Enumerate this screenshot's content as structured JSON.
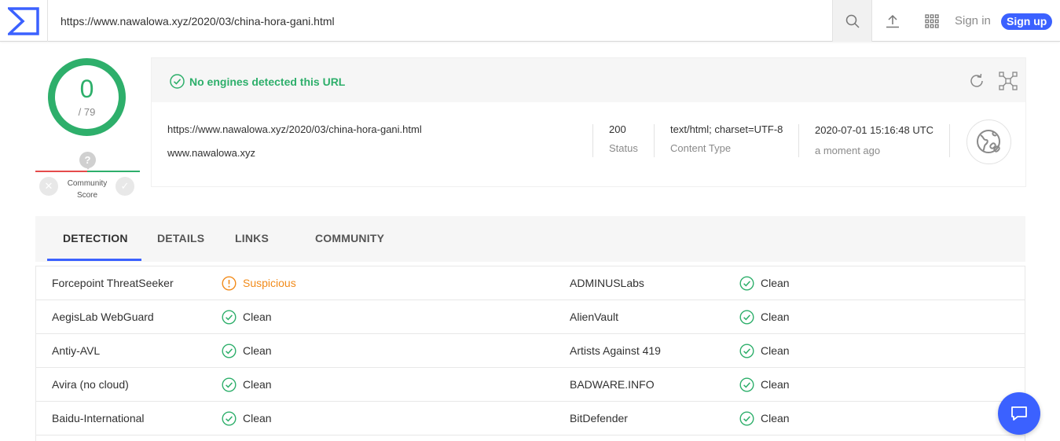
{
  "header": {
    "url_value": "https://www.nawalowa.xyz/2020/03/china-hora-gani.html",
    "signin_label": "Sign in",
    "signup_label": "Sign up",
    "icons": [
      "sigma-logo-icon",
      "search-icon",
      "upload-icon",
      "apps-grid-icon"
    ],
    "accent_color": "#3b61ff"
  },
  "score": {
    "detections": "0",
    "total": "/ 79",
    "community_label_line1": "Community",
    "community_label_line2": "Score",
    "community_value": "?",
    "colors": {
      "gauge": "#2eaf6b",
      "negative": "#e54b4b"
    }
  },
  "summary": {
    "verdict": "No engines detected this URL",
    "url": "https://www.nawalowa.xyz/2020/03/china-hora-gani.html",
    "domain": "www.nawalowa.xyz",
    "status_value": "200",
    "status_label": "Status",
    "content_type_value": "text/html; charset=UTF-8",
    "content_type_label": "Content Type",
    "date_value": "2020-07-01 15:16:48 UTC",
    "date_relative": "a moment ago"
  },
  "tabs": [
    {
      "label": "DETECTION",
      "active": true
    },
    {
      "label": "DETAILS",
      "active": false
    },
    {
      "label": "LINKS",
      "active": false
    },
    {
      "label": "COMMUNITY",
      "active": false
    }
  ],
  "detections": [
    {
      "left_engine": "Forcepoint ThreatSeeker",
      "left_result": "Suspicious",
      "left_status": "suspicious",
      "right_engine": "ADMINUSLabs",
      "right_result": "Clean",
      "right_status": "clean"
    },
    {
      "left_engine": "AegisLab WebGuard",
      "left_result": "Clean",
      "left_status": "clean",
      "right_engine": "AlienVault",
      "right_result": "Clean",
      "right_status": "clean"
    },
    {
      "left_engine": "Antiy-AVL",
      "left_result": "Clean",
      "left_status": "clean",
      "right_engine": "Artists Against 419",
      "right_result": "Clean",
      "right_status": "clean"
    },
    {
      "left_engine": "Avira (no cloud)",
      "left_result": "Clean",
      "left_status": "clean",
      "right_engine": "BADWARE.INFO",
      "right_result": "Clean",
      "right_status": "clean"
    },
    {
      "left_engine": "Baidu-International",
      "left_result": "Clean",
      "left_status": "clean",
      "right_engine": "BitDefender",
      "right_result": "Clean",
      "right_status": "clean"
    }
  ],
  "status_colors": {
    "clean": "#2eaf6b",
    "suspicious": "#f28b1a"
  }
}
